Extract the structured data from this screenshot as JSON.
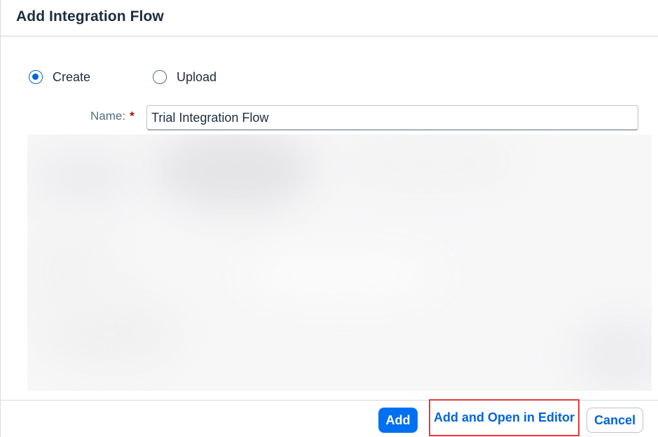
{
  "dialog": {
    "title": "Add Integration Flow"
  },
  "mode": {
    "options": [
      {
        "label": "Create",
        "selected": true
      },
      {
        "label": "Upload",
        "selected": false
      }
    ]
  },
  "form": {
    "name_label": "Name:",
    "required_marker": "*",
    "name_value": "Trial Integration Flow"
  },
  "footer": {
    "add_label": "Add",
    "add_open_label": "Add and Open in Editor",
    "cancel_label": "Cancel"
  },
  "colors": {
    "accent": "#0070f2",
    "link": "#0064d9",
    "title_text": "#1d2d3e",
    "label_text": "#556b82",
    "required": "#aa0808",
    "highlight_border": "#e03c3c"
  }
}
